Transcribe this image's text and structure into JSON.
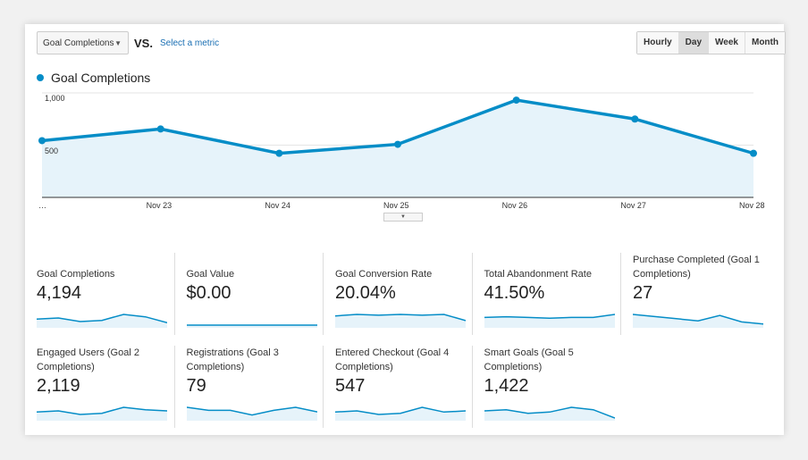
{
  "toolbar": {
    "metric": "Goal Completions",
    "vs": "VS.",
    "select_metric": "Select a metric",
    "periods": [
      "Hourly",
      "Day",
      "Week",
      "Month"
    ],
    "active_period": "Day"
  },
  "legend": "Goal Completions",
  "accent": "#058dc7",
  "chart_data": {
    "type": "area",
    "series": [
      {
        "name": "Goal Completions",
        "values": [
          543,
          655,
          422,
          508,
          931,
          750,
          422
        ]
      }
    ],
    "x": [
      "…",
      "Nov 23",
      "Nov 24",
      "Nov 25",
      "Nov 26",
      "Nov 27",
      "Nov 28"
    ],
    "y_ticks": [
      "1,000",
      "500"
    ],
    "ylim": [
      0,
      1150
    ],
    "grid": true
  },
  "metrics": [
    {
      "label": "Goal Completions",
      "value": "4,194",
      "spark": [
        5,
        6,
        3,
        4,
        9,
        7,
        2
      ]
    },
    {
      "label": "Goal Value",
      "value": "$0.00",
      "spark": [
        0,
        0,
        0,
        0,
        0,
        0,
        0
      ]
    },
    {
      "label": "Goal Conversion Rate",
      "value": "20.04%",
      "spark": [
        6,
        7,
        6.5,
        7,
        6.5,
        7,
        3
      ]
    },
    {
      "label": "Total Abandonment Rate",
      "value": "41.50%",
      "spark": [
        5,
        5.5,
        5,
        4.5,
        5,
        5,
        7
      ]
    },
    {
      "label": "Purchase Completed (Goal 1 Completions)",
      "value": "27",
      "spark": [
        10,
        8,
        6,
        4,
        9,
        3,
        1
      ]
    },
    {
      "label": "Engaged Users (Goal 2 Completions)",
      "value": "2,119",
      "spark": [
        5,
        6,
        3,
        4,
        9,
        7,
        6
      ]
    },
    {
      "label": "Registrations (Goal 3 Completions)",
      "value": "79",
      "spark": [
        7,
        5,
        5,
        2,
        5,
        7,
        4
      ]
    },
    {
      "label": "Entered Checkout (Goal 4 Completions)",
      "value": "547",
      "spark": [
        5,
        6,
        3,
        4,
        9,
        5,
        6
      ]
    },
    {
      "label": "Smart Goals (Goal 5 Completions)",
      "value": "1,422",
      "spark": [
        6,
        7,
        4,
        5,
        9,
        7,
        0
      ]
    }
  ]
}
